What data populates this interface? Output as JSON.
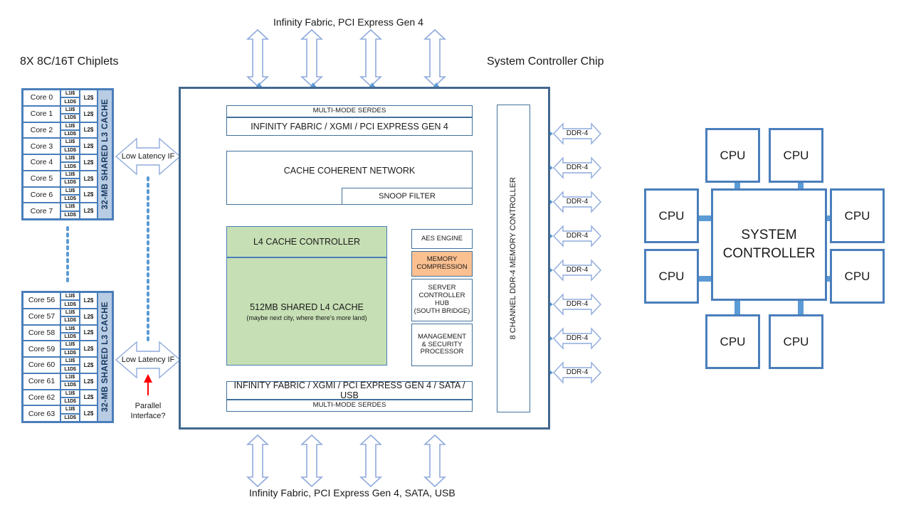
{
  "headings": {
    "chiplets": "8X 8C/16T Chiplets",
    "system_controller_chip": "System Controller Chip",
    "top_io": "Infinity Fabric, PCI Express Gen 4",
    "bottom_io": "Infinity Fabric, PCI Express Gen 4, SATA, USB"
  },
  "chiplet_top": {
    "cores": [
      "Core 0",
      "Core 1",
      "Core 2",
      "Core 3",
      "Core 4",
      "Core 5",
      "Core 6",
      "Core 7"
    ],
    "l1i": "L1I$",
    "l1d": "L1D$",
    "l2": "L2$",
    "l3": "32-MB SHARED  L3 CACHE"
  },
  "chiplet_bottom": {
    "cores": [
      "Core 56",
      "Core 57",
      "Core 58",
      "Core 59",
      "Core 60",
      "Core 61",
      "Core 62",
      "Core 63"
    ],
    "l1i": "L1I$",
    "l1d": "L1D$",
    "l2": "L2$",
    "l3": "32-MB SHARED  L3 CACHE"
  },
  "interfaces": {
    "low_latency_top": "Low Latency IF",
    "low_latency_bottom": "Low Latency IF",
    "parallel_note_line1": "Parallel",
    "parallel_note_line2": "Interface?"
  },
  "chip": {
    "serdes_top": "MULTI-MODE SERDES",
    "fabric_top": "INFINITY FABRIC / XGMI / PCI EXPRESS GEN  4",
    "cache_coherent_network": "CACHE  COHERENT  NETWORK",
    "snoop_filter": "SNOOP FILTER",
    "l4_controller": "L4 CACHE  CONTROLLER",
    "l4_cache_line1": "512MB SHARED  L4 CACHE",
    "l4_cache_line2": "(maybe next city, where there’s more land)",
    "fabric_bottom": "INFINITY FABRIC / XGMI / PCI EXPRESS GEN  4 / SATA  / USB",
    "serdes_bottom": "MULTI-MODE SERDES",
    "memory_controller": "8 CHANNEL  DDR-4  MEMORY CONTROLLER",
    "modules": [
      {
        "name": "aes-engine",
        "lines": [
          "AES ENGINE"
        ],
        "fill": "#ffffff"
      },
      {
        "name": "memory-compression",
        "lines": [
          "MEMORY",
          "COMPRESSION"
        ],
        "fill": "#fac090"
      },
      {
        "name": "server-controller-hub",
        "lines": [
          "SERVER",
          "CONTROLLER HUB",
          "(SOUTH BRIDGE)"
        ],
        "fill": "#ffffff"
      },
      {
        "name": "management-security-processor",
        "lines": [
          "MANAGEMENT",
          "& SECURITY",
          "PROCESSOR"
        ],
        "fill": "#ffffff"
      }
    ]
  },
  "memory": {
    "channels": [
      "DDR-4",
      "DDR-4",
      "DDR-4",
      "DDR-4",
      "DDR-4",
      "DDR-4",
      "DDR-4",
      "DDR-4"
    ]
  },
  "topology": {
    "center_line1": "SYSTEM",
    "center_line2": "CONTROLLER",
    "cpus": [
      "CPU",
      "CPU",
      "CPU",
      "CPU",
      "CPU",
      "CPU",
      "CPU",
      "CPU"
    ]
  },
  "colors": {
    "chip_border": "#43688f",
    "box_border": "#41719c",
    "l3_fill": "#b8cce4",
    "l4_fill": "#c6dfb4",
    "memory_compression_fill": "#fac090",
    "arrow_blue": "#5b9bd5",
    "outline_arrow_stroke": "#8faadc",
    "red_arrow": "#ff0000",
    "dotted_blue": "#5b9bd5"
  }
}
